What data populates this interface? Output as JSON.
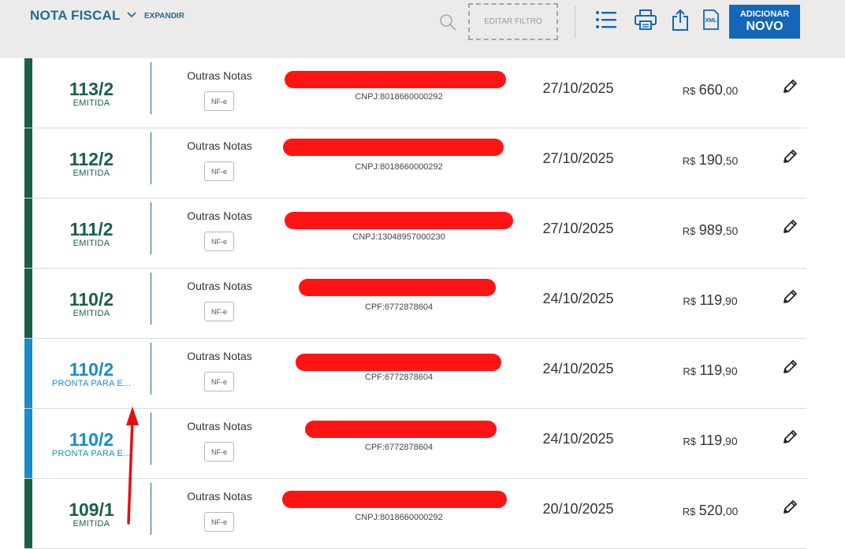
{
  "header": {
    "title": "NOTA FISCAL",
    "expand_label": "EXPANDIR",
    "filter_label": "EDITAR FILTRO",
    "tool_icons": [
      "list-icon",
      "printer-icon",
      "share-icon",
      "xml-icon"
    ],
    "xml_label": "XML",
    "add_button": {
      "line1": "ADICIONAR",
      "line2": "NOVO"
    }
  },
  "colors": {
    "emitida": "#1b5e4c",
    "pronta": "#1a8ac8",
    "accent": "#1466b8",
    "redaction": "#ff1414",
    "annotation_arrow": "#e31010"
  },
  "rows": [
    {
      "number": "113/2",
      "status": "EMITIDA",
      "status_key": "emitida",
      "type": "Outras Notas",
      "badge": "NF-e",
      "doc": "CNPJ:8018660000292",
      "date": "27/10/2025",
      "currency": "R$",
      "value_int": "660",
      "value_dec": ",00"
    },
    {
      "number": "112/2",
      "status": "EMITIDA",
      "status_key": "emitida",
      "type": "Outras Notas",
      "badge": "NF-e",
      "doc": "CNPJ:8018660000292",
      "date": "27/10/2025",
      "currency": "R$",
      "value_int": "190",
      "value_dec": ",50"
    },
    {
      "number": "111/2",
      "status": "EMITIDA",
      "status_key": "emitida",
      "type": "Outras Notas",
      "badge": "NF-e",
      "doc": "CNPJ:13048957000230",
      "date": "27/10/2025",
      "currency": "R$",
      "value_int": "989",
      "value_dec": ",50"
    },
    {
      "number": "110/2",
      "status": "EMITIDA",
      "status_key": "emitida",
      "type": "Outras Notas",
      "badge": "NF-e",
      "doc": "CPF:6772878604",
      "date": "24/10/2025",
      "currency": "R$",
      "value_int": "119",
      "value_dec": ",90"
    },
    {
      "number": "110/2",
      "status": "PRONTA PARA E...",
      "status_key": "pronta",
      "type": "Outras Notas",
      "badge": "NF-e",
      "doc": "CPF:6772878604",
      "date": "24/10/2025",
      "currency": "R$",
      "value_int": "119",
      "value_dec": ",90"
    },
    {
      "number": "110/2",
      "status": "PRONTA PARA E...",
      "status_key": "pronta",
      "type": "Outras Notas",
      "badge": "NF-e",
      "doc": "CPF:6772878604",
      "date": "24/10/2025",
      "currency": "R$",
      "value_int": "119",
      "value_dec": ",90"
    },
    {
      "number": "109/1",
      "status": "EMITIDA",
      "status_key": "emitida",
      "type": "Outras Notas",
      "badge": "NF-e",
      "doc": "CNPJ:8018660000292",
      "date": "20/10/2025",
      "currency": "R$",
      "value_int": "520",
      "value_dec": ",00"
    }
  ]
}
